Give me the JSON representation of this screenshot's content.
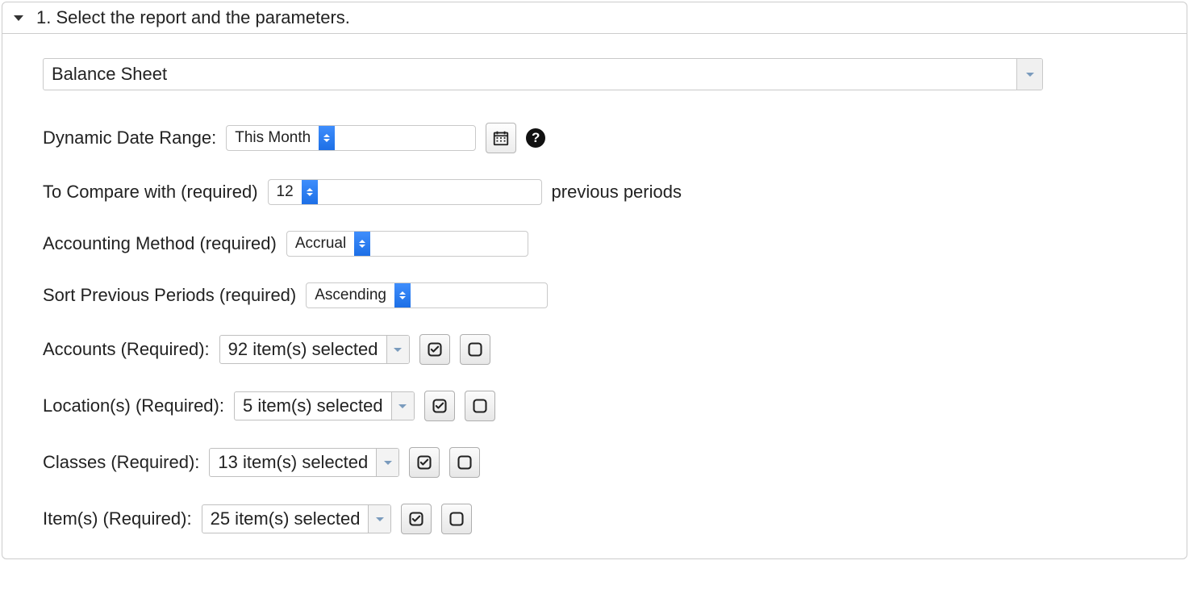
{
  "header": {
    "title": "1. Select the report and the parameters."
  },
  "report": {
    "selected": "Balance Sheet"
  },
  "dateRange": {
    "label": "Dynamic Date Range:",
    "value": "This Month"
  },
  "compare": {
    "label": "To Compare with (required)",
    "value": "12",
    "suffix": "previous periods"
  },
  "accountingMethod": {
    "label": "Accounting Method (required)",
    "value": "Accrual"
  },
  "sortPrevious": {
    "label": "Sort Previous Periods (required)",
    "value": "Ascending"
  },
  "accounts": {
    "label": "Accounts (Required):",
    "value": "92 item(s) selected"
  },
  "locations": {
    "label": "Location(s) (Required):",
    "value": "5 item(s) selected"
  },
  "classes": {
    "label": "Classes (Required):",
    "value": "13 item(s) selected"
  },
  "items": {
    "label": "Item(s) (Required):",
    "value": "25 item(s) selected"
  },
  "helpGlyph": "?"
}
